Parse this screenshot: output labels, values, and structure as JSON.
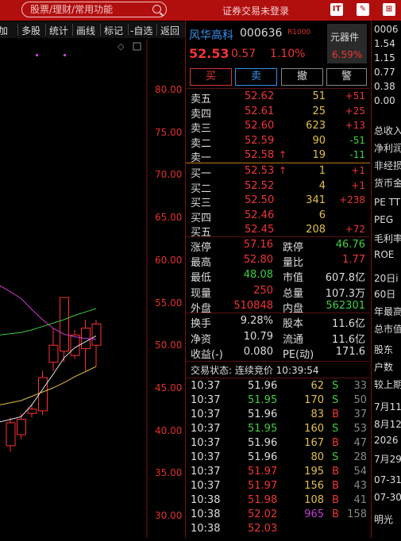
{
  "topbar": {
    "search_placeholder": "股票/理财/常用功能",
    "login_status": "证券交易未登录",
    "icons": [
      "window-icon",
      "edit-icon",
      "gift-icon"
    ],
    "icon_glyphs": [
      "IT",
      "✎",
      "⊞"
    ]
  },
  "toolbar": {
    "items": [
      "加",
      "多股",
      "统计",
      "画线",
      "标记",
      "-自选",
      "返回"
    ]
  },
  "chart": {
    "y_ticks": [
      "80.00",
      "75.00",
      "70.00",
      "65.00",
      "60.00",
      "55.00",
      "50.00",
      "45.00",
      "40.00",
      "35.00",
      "30.00"
    ],
    "candles": [
      {
        "open": 38.2,
        "close": 40.9,
        "high": 41.5,
        "low": 37.5
      },
      {
        "open": 39.5,
        "close": 41.3,
        "high": 42.0,
        "low": 39.0
      },
      {
        "open": 42.0,
        "close": 42.5,
        "high": 43.0,
        "low": 41.5
      },
      {
        "open": 42.3,
        "close": 46.2,
        "high": 47.0,
        "low": 41.8
      },
      {
        "open": 48.0,
        "close": 50.0,
        "high": 52.0,
        "low": 47.0
      },
      {
        "open": 49.3,
        "close": 55.6,
        "high": 55.6,
        "low": 48.0
      },
      {
        "open": 48.8,
        "close": 51.2,
        "high": 51.8,
        "low": 48.4
      },
      {
        "open": 49.6,
        "close": 52.0,
        "high": 53.0,
        "low": 47.0
      },
      {
        "open": 50.0,
        "close": 52.5,
        "high": 53.0,
        "low": 47.5
      }
    ],
    "ma_lines": [
      {
        "color": "#e0e0e0",
        "values": [
          41.0,
          41.6,
          43.0,
          44.8,
          46.6,
          48.5,
          49.7,
          50.4,
          51.1
        ]
      },
      {
        "color": "#e0c04a",
        "values": [
          43.0,
          43.5,
          44.0,
          44.5,
          45.0,
          45.6,
          46.3,
          46.9,
          47.5
        ]
      },
      {
        "color": "#d338d3",
        "values": [
          57.0,
          55.5,
          54.2,
          53.0,
          52.0,
          51.3,
          51.0,
          50.8,
          50.7
        ]
      },
      {
        "color": "#3ec83e",
        "values": [
          51.2,
          51.5,
          51.8,
          52.2,
          52.6,
          53.0,
          53.5,
          53.9,
          54.3
        ]
      }
    ],
    "colors": {
      "up": "#ff3030",
      "down": "#20d8d8",
      "tick": "#e0322a"
    }
  },
  "stock": {
    "name": "风华高科",
    "code": "000636",
    "level": "R1000",
    "price": "52.53",
    "change": "0.57",
    "change_pct": "1.10%",
    "widget_label": "元器件",
    "widget_pct": "6.59%"
  },
  "buttons": {
    "buy": "买",
    "sell": "卖",
    "cancel": "撤",
    "warn": "警"
  },
  "asks": [
    {
      "label": "卖五",
      "price": "52.62",
      "vol": "51",
      "delta": "+51"
    },
    {
      "label": "卖四",
      "price": "52.61",
      "vol": "25",
      "delta": "+25"
    },
    {
      "label": "卖三",
      "price": "52.60",
      "vol": "623",
      "delta": "+13"
    },
    {
      "label": "卖二",
      "price": "52.59",
      "vol": "90",
      "delta": "-51"
    },
    {
      "label": "卖一",
      "price": "52.58",
      "vol": "19",
      "delta": "-11",
      "arrow": "↑"
    }
  ],
  "bids": [
    {
      "label": "买一",
      "price": "52.53",
      "vol": "1",
      "delta": "+1",
      "arrow": "↑"
    },
    {
      "label": "买二",
      "price": "52.52",
      "vol": "4",
      "delta": "+1"
    },
    {
      "label": "买三",
      "price": "52.50",
      "vol": "341",
      "delta": "+238"
    },
    {
      "label": "买四",
      "price": "52.46",
      "vol": "6",
      "delta": ""
    },
    {
      "label": "买五",
      "price": "52.45",
      "vol": "208",
      "delta": "+72"
    }
  ],
  "quote1": [
    [
      {
        "t": "涨停",
        "c": "white"
      },
      {
        "t": "57.16",
        "c": "red"
      },
      {
        "t": "跌停",
        "c": "white"
      },
      {
        "t": "46.76",
        "c": "green"
      }
    ],
    [
      {
        "t": "最高",
        "c": "white"
      },
      {
        "t": "52.80",
        "c": "red"
      },
      {
        "t": "量比",
        "c": "white"
      },
      {
        "t": "1.77",
        "c": "red"
      }
    ],
    [
      {
        "t": "最低",
        "c": "white"
      },
      {
        "t": "48.08",
        "c": "green"
      },
      {
        "t": "市值",
        "c": "white"
      },
      {
        "t": "607.8亿",
        "c": "white"
      }
    ],
    [
      {
        "t": "现量",
        "c": "white"
      },
      {
        "t": "250",
        "c": "red"
      },
      {
        "t": "总量",
        "c": "white"
      },
      {
        "t": "107.3万",
        "c": "white"
      }
    ],
    [
      {
        "t": "外盘",
        "c": "white"
      },
      {
        "t": "510848",
        "c": "red"
      },
      {
        "t": "内盘",
        "c": "white"
      },
      {
        "t": "562301",
        "c": "green"
      }
    ]
  ],
  "quote2": [
    [
      {
        "t": "换手",
        "c": "white"
      },
      {
        "t": "9.28%",
        "c": "white"
      },
      {
        "t": "股本",
        "c": "white"
      },
      {
        "t": "11.6亿",
        "c": "white"
      }
    ],
    [
      {
        "t": "净资",
        "c": "white"
      },
      {
        "t": "10.79",
        "c": "white"
      },
      {
        "t": "流通",
        "c": "white"
      },
      {
        "t": "11.6亿",
        "c": "white"
      }
    ],
    [
      {
        "t": "收益(-)",
        "c": "white"
      },
      {
        "t": "0.080",
        "c": "white"
      },
      {
        "t": "PE(动)",
        "c": "white"
      },
      {
        "t": "171.6",
        "c": "white"
      }
    ]
  ],
  "trade_state": "交易状态: 连续竞价 10:39:54",
  "ticks": [
    {
      "time": "10:37",
      "price": "51.96",
      "pc": "white",
      "vol": "62",
      "side": "S",
      "n": "33"
    },
    {
      "time": "10:37",
      "price": "51.95",
      "pc": "green",
      "vol": "170",
      "side": "S",
      "n": "50"
    },
    {
      "time": "10:37",
      "price": "51.96",
      "pc": "white",
      "vol": "83",
      "side": "B",
      "n": "37"
    },
    {
      "time": "10:37",
      "price": "51.95",
      "pc": "green",
      "vol": "160",
      "side": "S",
      "n": "53"
    },
    {
      "time": "10:37",
      "price": "51.96",
      "pc": "white",
      "vol": "167",
      "side": "B",
      "n": "47"
    },
    {
      "time": "10:37",
      "price": "51.96",
      "pc": "white",
      "vol": "80",
      "side": "S",
      "n": "28"
    },
    {
      "time": "10:37",
      "price": "51.97",
      "pc": "red",
      "vol": "195",
      "side": "B",
      "n": "54"
    },
    {
      "time": "10:37",
      "price": "51.97",
      "pc": "red",
      "vol": "156",
      "side": "B",
      "n": "43"
    },
    {
      "time": "10:38",
      "price": "51.98",
      "pc": "red",
      "vol": "108",
      "side": "B",
      "n": "41"
    },
    {
      "time": "10:38",
      "price": "52.02",
      "pc": "red",
      "vol": "965",
      "side": "B",
      "n": "158",
      "vc": "purple"
    },
    {
      "time": "10:38",
      "price": "52.03",
      "pc": "red",
      "vol": "",
      "side": "",
      "n": ""
    }
  ],
  "far_right": [
    {
      "t": "0006"
    },
    {
      "t": "1.54"
    },
    {
      "t": "1.15"
    },
    {
      "t": "0.77"
    },
    {
      "t": "0.38"
    },
    {
      "t": "0.00"
    },
    {
      "t": "总收入"
    },
    {
      "t": "净利润"
    },
    {
      "t": "非经损"
    },
    {
      "t": "货币金"
    },
    {
      "t": "PE TTM"
    },
    {
      "t": "PEG"
    },
    {
      "t": "毛利率"
    },
    {
      "t": "ROE"
    },
    {
      "t": "20日i"
    },
    {
      "t": "60日"
    },
    {
      "t": "年最高"
    },
    {
      "t": "总市值"
    },
    {
      "t": "股东"
    },
    {
      "t": "户数"
    },
    {
      "t": "较上期"
    },
    {
      "t": "7月11"
    },
    {
      "t": "8月12"
    },
    {
      "t": "2026"
    },
    {
      "t": "7月29"
    },
    {
      "t": "07-31"
    },
    {
      "t": "07-30"
    },
    {
      "t": "明光"
    }
  ]
}
